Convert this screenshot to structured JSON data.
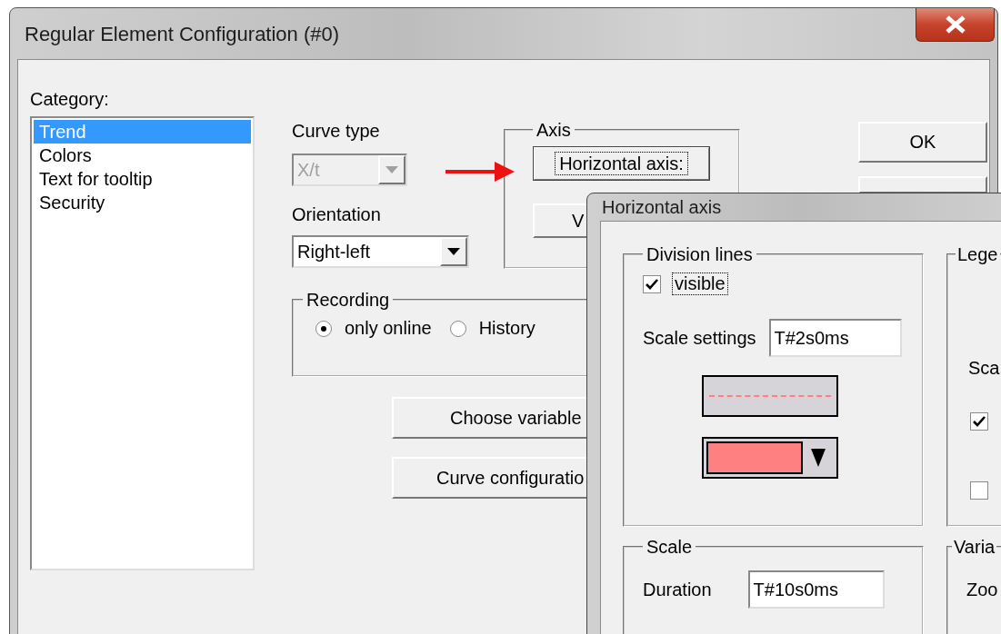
{
  "window": {
    "title": "Regular Element Configuration (#0)"
  },
  "category": {
    "label": "Category:",
    "items": [
      {
        "label": "Trend",
        "selected": true
      },
      {
        "label": "Colors",
        "selected": false
      },
      {
        "label": "Text for tooltip",
        "selected": false
      },
      {
        "label": "Security",
        "selected": false
      }
    ]
  },
  "curve_type": {
    "label": "Curve type",
    "value": "X/t",
    "disabled": true
  },
  "orientation": {
    "label": "Orientation",
    "value": "Right-left",
    "disabled": false
  },
  "axis": {
    "label": "Axis",
    "buttons": [
      {
        "label": "Horizontal axis:",
        "focused": true
      },
      {
        "label": "V",
        "focused": false
      }
    ]
  },
  "recording": {
    "label": "Recording",
    "options": [
      {
        "label": "only online",
        "selected": true
      },
      {
        "label": "History",
        "selected": false
      }
    ]
  },
  "actions": [
    "Choose variable",
    "Curve configuratio"
  ],
  "dialog_buttons": [
    "OK"
  ],
  "horizontal_axis_dialog": {
    "title": "Horizontal axis",
    "division_lines": {
      "label": "Division lines",
      "visible": {
        "label": "visible",
        "checked": true
      },
      "scale_settings": {
        "label": "Scale settings",
        "value": "T#2s0ms"
      }
    },
    "legend": {
      "label": "Lege",
      "scale_label": "Sca",
      "checkboxes": [
        {
          "checked": true
        },
        {
          "checked": false
        }
      ]
    },
    "scale": {
      "label": "Scale",
      "duration": {
        "label": "Duration",
        "value": "T#10s0ms"
      }
    },
    "variable": {
      "label": "Varia",
      "zoom_label": "Zoo"
    }
  }
}
